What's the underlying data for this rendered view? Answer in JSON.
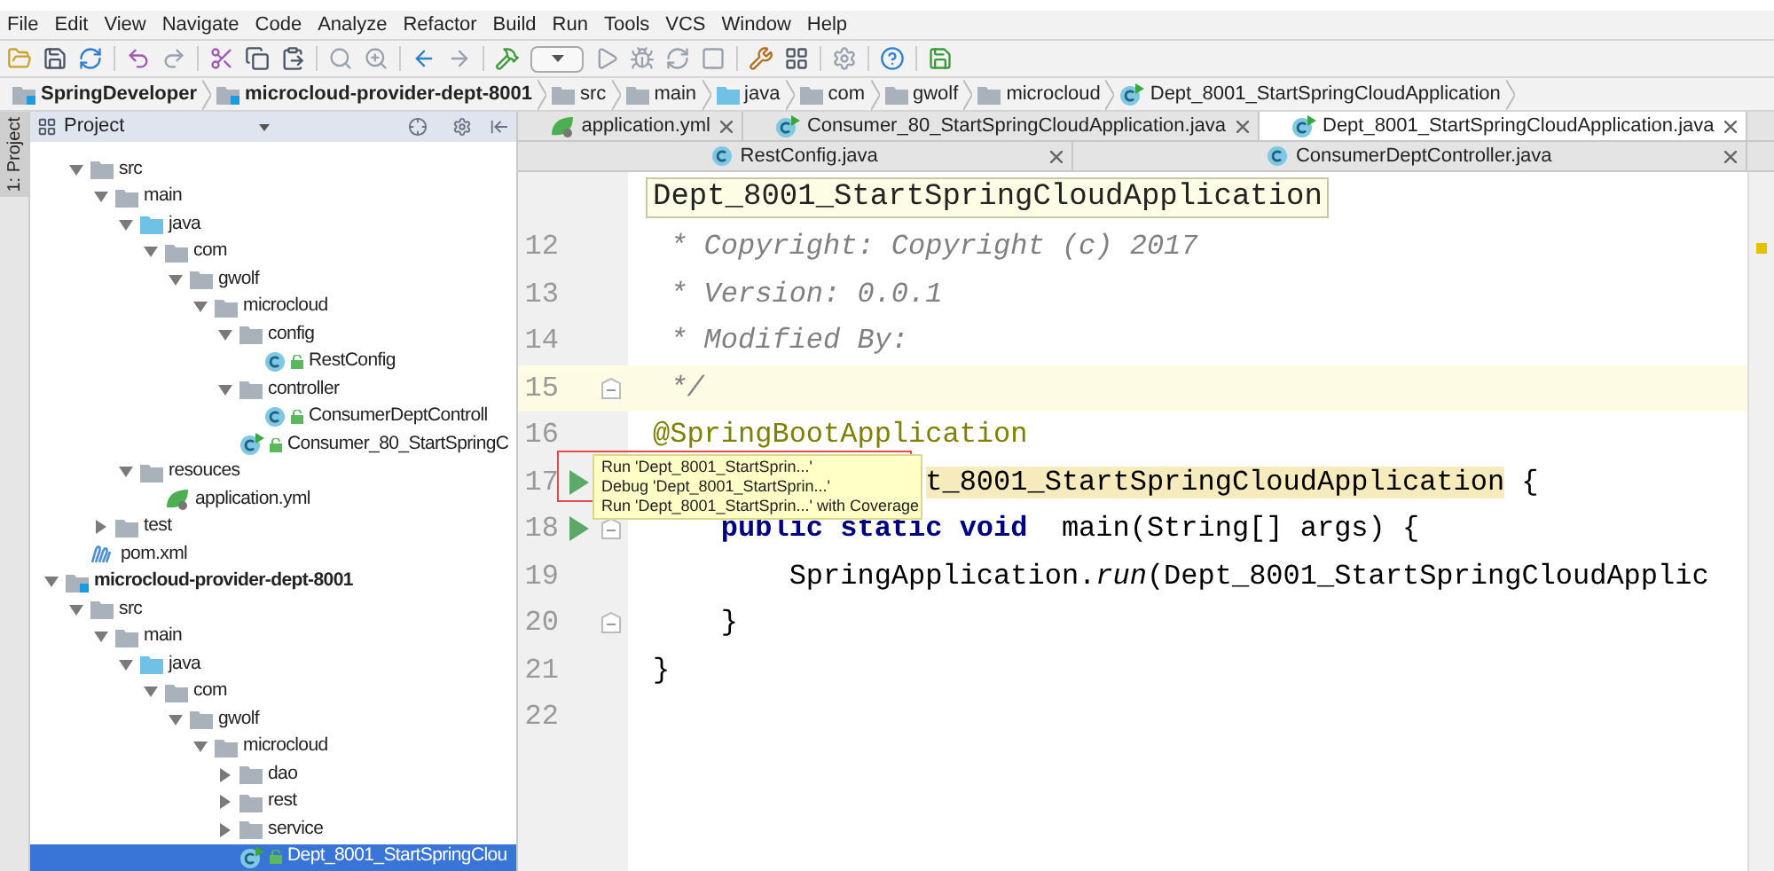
{
  "menu": [
    "File",
    "Edit",
    "View",
    "Navigate",
    "Code",
    "Analyze",
    "Refactor",
    "Build",
    "Run",
    "Tools",
    "VCS",
    "Window",
    "Help"
  ],
  "breadcrumbs": [
    {
      "label": "SpringDeveloper",
      "kind": "module"
    },
    {
      "label": "microcloud-provider-dept-8001",
      "kind": "module"
    },
    {
      "label": "src",
      "kind": "folder"
    },
    {
      "label": "main",
      "kind": "folder"
    },
    {
      "label": "java",
      "kind": "source-folder"
    },
    {
      "label": "com",
      "kind": "folder"
    },
    {
      "label": "gwolf",
      "kind": "folder"
    },
    {
      "label": "microcloud",
      "kind": "folder"
    },
    {
      "label": "Dept_8001_StartSpringCloudApplication",
      "kind": "main-class"
    }
  ],
  "side_strip": {
    "label": "1: Project"
  },
  "project_panel": {
    "title": "Project",
    "continued_items": [
      {
        "label": "src",
        "kind": "folder",
        "expanded": true,
        "selected": false,
        "children": [
          {
            "label": "main",
            "kind": "folder",
            "expanded": true,
            "selected": false,
            "children": [
              {
                "label": "java",
                "kind": "source-folder",
                "expanded": true,
                "selected": false,
                "children": [
                  {
                    "label": "com",
                    "kind": "folder",
                    "expanded": true,
                    "selected": false,
                    "children": [
                      {
                        "label": "gwolf",
                        "kind": "folder",
                        "expanded": true,
                        "selected": false,
                        "children": [
                          {
                            "label": "microcloud",
                            "kind": "folder",
                            "expanded": true,
                            "selected": false,
                            "children": [
                              {
                                "label": "config",
                                "kind": "folder",
                                "expanded": true,
                                "selected": false,
                                "children": [
                                  {
                                    "label": "RestConfig",
                                    "kind": "class",
                                    "selected": false
                                  }
                                ]
                              },
                              {
                                "label": "controller",
                                "kind": "folder",
                                "expanded": true,
                                "selected": false,
                                "children": [
                                  {
                                    "label": "ConsumerDeptControll",
                                    "kind": "class",
                                    "selected": false
                                  }
                                ]
                              },
                              {
                                "label": "Consumer_80_StartSpringC",
                                "kind": "main-class",
                                "selected": false
                              }
                            ]
                          }
                        ]
                      }
                    ]
                  }
                ]
              },
              {
                "label": "resouces",
                "kind": "folder",
                "expanded": true,
                "selected": false,
                "children": [
                  {
                    "label": "application.yml",
                    "kind": "yml",
                    "selected": false
                  }
                ]
              }
            ]
          },
          {
            "label": "test",
            "kind": "folder",
            "expanded": false,
            "selected": false
          }
        ]
      },
      {
        "label": "pom.xml",
        "kind": "maven",
        "selected": false
      }
    ],
    "modules": [
      {
        "label": "microcloud-provider-dept-8001",
        "kind": "module",
        "expanded": true,
        "selected": false,
        "children": [
          {
            "label": "src",
            "kind": "folder",
            "expanded": true,
            "selected": false,
            "children": [
              {
                "label": "main",
                "kind": "folder",
                "expanded": true,
                "selected": false,
                "children": [
                  {
                    "label": "java",
                    "kind": "source-folder",
                    "expanded": true,
                    "selected": false,
                    "children": [
                      {
                        "label": "com",
                        "kind": "folder",
                        "expanded": true,
                        "selected": false,
                        "children": [
                          {
                            "label": "gwolf",
                            "kind": "folder",
                            "expanded": true,
                            "selected": false,
                            "children": [
                              {
                                "label": "microcloud",
                                "kind": "folder",
                                "expanded": true,
                                "selected": false,
                                "children": [
                                  {
                                    "label": "dao",
                                    "kind": "folder",
                                    "expanded": false,
                                    "selected": false
                                  },
                                  {
                                    "label": "rest",
                                    "kind": "folder",
                                    "expanded": false,
                                    "selected": false
                                  },
                                  {
                                    "label": "service",
                                    "kind": "folder",
                                    "expanded": false,
                                    "selected": false
                                  },
                                  {
                                    "label": "Dept_8001_StartSpringClou",
                                    "kind": "main-class",
                                    "selected": true
                                  }
                                ]
                              }
                            ]
                          }
                        ]
                      }
                    ]
                  }
                ]
              }
            ]
          }
        ]
      }
    ]
  },
  "tab_rows": [
    [
      {
        "label": "application.yml",
        "kind": "yml",
        "selected": false
      },
      {
        "label": "Consumer_80_StartSpringCloudApplication.java",
        "kind": "main-class",
        "selected": false
      },
      {
        "label": "Dept_8001_StartSpringCloudApplication.java",
        "kind": "main-class",
        "selected": true
      }
    ],
    [
      {
        "label": "RestConfig.java",
        "kind": "class",
        "selected": false
      },
      {
        "label": "ConsumerDeptController.java",
        "kind": "class",
        "selected": false
      }
    ]
  ],
  "editor": {
    "header": "Dept_8001_StartSpringCloudApplication",
    "lines": [
      {
        "number": "12",
        "current": false,
        "run": false,
        "fold": false,
        "segments": [
          {
            "text": " * Copyright: Copyright (c) 2017",
            "kind": "comment"
          }
        ]
      },
      {
        "number": "13",
        "current": false,
        "run": false,
        "fold": false,
        "segments": [
          {
            "text": " * Version: 0.0.1",
            "kind": "comment"
          }
        ]
      },
      {
        "number": "14",
        "current": false,
        "run": false,
        "fold": false,
        "segments": [
          {
            "text": " * Modified By:",
            "kind": "comment"
          }
        ]
      },
      {
        "number": "15",
        "current": true,
        "run": false,
        "fold": true,
        "segments": [
          {
            "text": " */",
            "kind": "comment"
          }
        ]
      },
      {
        "number": "16",
        "current": false,
        "run": false,
        "fold": false,
        "segments": [
          {
            "text": "@SpringBootApplication",
            "kind": "annotation"
          }
        ]
      },
      {
        "number": "17",
        "current": false,
        "run": true,
        "fold": false,
        "segments": [
          {
            "text": "                t_8001_StartSpringCloudApplication",
            "kind": "highlight"
          },
          {
            "text": " {",
            "kind": "plain"
          }
        ]
      },
      {
        "number": "18",
        "current": false,
        "run": true,
        "fold": true,
        "segments": [
          {
            "text": "    public static void",
            "kind": "keyword"
          },
          {
            "text": "  main(String[] args) {",
            "kind": "plain"
          }
        ]
      },
      {
        "number": "19",
        "current": false,
        "run": false,
        "fold": false,
        "segments": [
          {
            "text": "        SpringApplication.",
            "kind": "plain"
          },
          {
            "text": "run",
            "kind": "italic"
          },
          {
            "text": "(Dept_8001_StartSpringCloudApplic",
            "kind": "plain"
          }
        ]
      },
      {
        "number": "20",
        "current": false,
        "run": false,
        "fold": true,
        "segments": [
          {
            "text": "    }",
            "kind": "plain"
          }
        ]
      },
      {
        "number": "21",
        "current": false,
        "run": false,
        "fold": false,
        "segments": [
          {
            "text": "}",
            "kind": "plain"
          }
        ]
      },
      {
        "number": "22",
        "current": false,
        "run": false,
        "fold": false
      }
    ],
    "run_popup": [
      "Run 'Dept_8001_StartSprin...'",
      "Debug 'Dept_8001_StartSprin...'",
      "Run 'Dept_8001_StartSprin...' with Coverage"
    ]
  }
}
